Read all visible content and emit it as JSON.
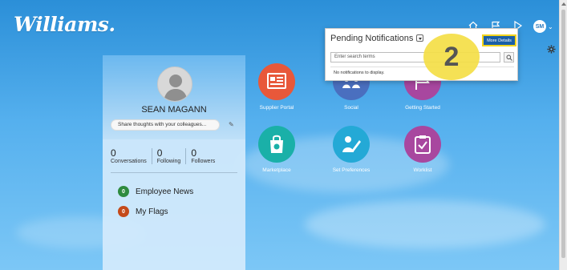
{
  "brand": {
    "logo_text": "Williams."
  },
  "header": {
    "icons": [
      "home-icon",
      "flag-icon",
      "notification-icon"
    ],
    "user_initials": "SM",
    "settings_icon": "gear-icon"
  },
  "profile": {
    "name": "SEAN MAGANN",
    "share_placeholder": "Share thoughts with your colleagues...",
    "stats": [
      {
        "value": "0",
        "label": "Conversations"
      },
      {
        "value": "0",
        "label": "Following"
      },
      {
        "value": "0",
        "label": "Followers"
      }
    ],
    "links": [
      {
        "count": "0",
        "label": "Employee News",
        "color": "#2e8b3f"
      },
      {
        "count": "0",
        "label": "My Flags",
        "color": "#c44a1a"
      }
    ]
  },
  "tiles": [
    {
      "label": "Supplier Portal",
      "icon": "supplier-portal-icon",
      "color": "#e8583a"
    },
    {
      "label": "Social",
      "icon": "social-icon",
      "color": "#4a6fbf"
    },
    {
      "label": "Getting Started",
      "icon": "getting-started-icon",
      "color": "#a8479f"
    },
    {
      "label": "Marketplace",
      "icon": "marketplace-icon",
      "color": "#1ab0a8"
    },
    {
      "label": "Set Preferences",
      "icon": "preferences-icon",
      "color": "#24a9d6"
    },
    {
      "label": "Worklist",
      "icon": "worklist-icon",
      "color": "#a8479f"
    }
  ],
  "notifications": {
    "title": "Pending Notifications",
    "more_details": "More Details",
    "search_placeholder": "Enter search terms",
    "empty_message": "No notifications to display."
  },
  "step_marker": "2",
  "colors": {
    "accent": "#1a5fa6",
    "highlight": "#f2d41b"
  }
}
